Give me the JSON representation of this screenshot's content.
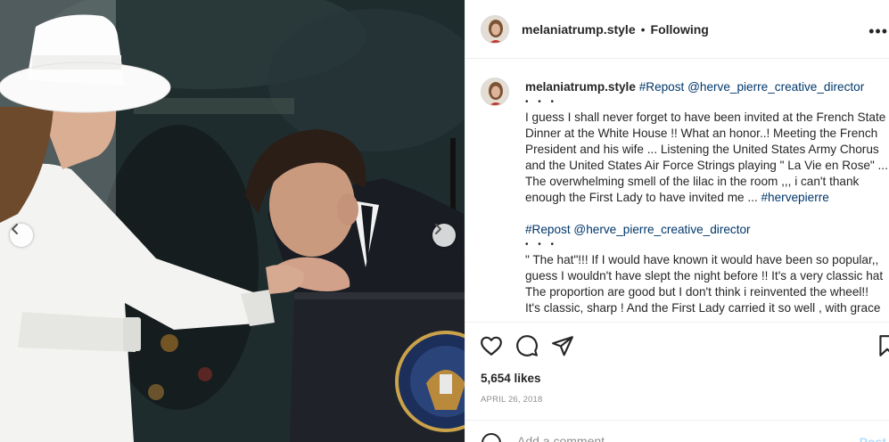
{
  "post": {
    "username": "melaniatrump.style",
    "separator": "•",
    "follow_status": "Following",
    "more_options_icon": "more-horizontal-icon"
  },
  "caption": {
    "username": "melaniatrump.style",
    "repost_link_1": "#Repost @herve_pierre_creative_director",
    "dots_1": "• • •",
    "paragraph_1": [
      "I guess I shall never forget to have been invited at the French State",
      "Dinner at the White House !! What an honor..! Meeting the French",
      "President and his wife ... Listening the United States Army Chorus",
      "and the United States Air Force Strings playing \" La Vie en Rose\" ...",
      "The overwhelming smell of the lilac in the room ,,, i can't thank"
    ],
    "paragraph_1_last": "enough the First Lady to have invited me ... ",
    "hashtag": "#hervepierre",
    "repost_link_2": "#Repost @herve_pierre_creative_director",
    "dots_2": "• • •",
    "paragraph_2": [
      "\" The hat\"!!! If I would have known it would have been so popular,,",
      "guess I wouldn't have slept the night before !! It's a very classic hat",
      "The proportion are good but I don't think i reinvented the wheel!!",
      "It's classic, sharp ! And the First Lady carried it so well , with grace"
    ]
  },
  "actions": {
    "like_icon": "heart-icon",
    "comment_icon": "comment-icon",
    "share_icon": "paper-plane-icon",
    "save_icon": "bookmark-icon"
  },
  "likes": "5,654 likes",
  "date": "APRIL 26, 2018",
  "comment_box": {
    "placeholder": "Add a comment...",
    "post_label": "Post"
  },
  "carousel": {
    "prev_icon": "chevron-left-icon",
    "next_icon": "chevron-right-icon"
  },
  "colors": {
    "link": "#00376b",
    "text": "#262626",
    "muted": "#8e8e8e",
    "border": "#efefef",
    "post_disabled": "#b2dffc"
  }
}
